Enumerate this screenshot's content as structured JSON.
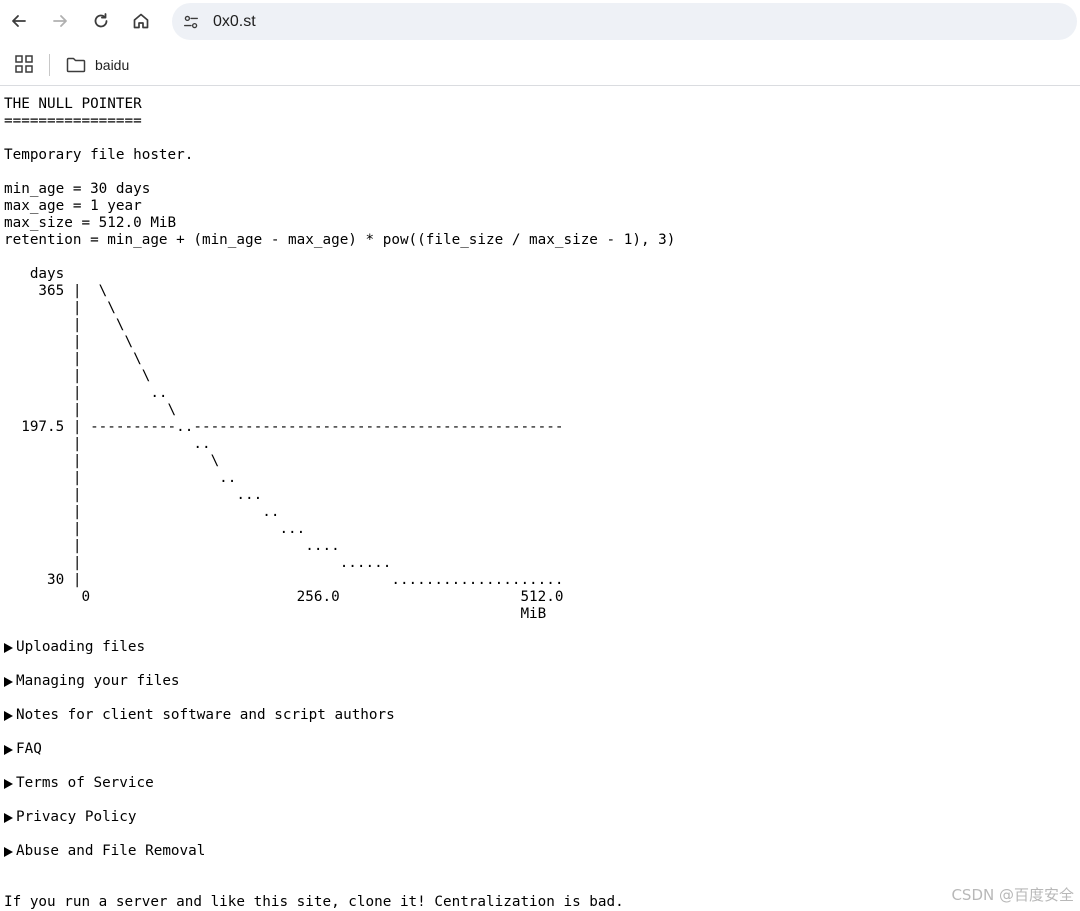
{
  "browser": {
    "url": "0x0.st",
    "bookmarks": [
      {
        "label": "baidu"
      }
    ]
  },
  "page": {
    "title": "THE NULL POINTER",
    "underline": "================",
    "tagline": "Temporary file hoster.",
    "params": [
      "min_age = 30 days",
      "max_age = 1 year",
      "max_size = 512.0 MiB",
      "retention = min_age + (min_age - max_age) * pow((file_size / max_size - 1), 3)"
    ],
    "chart_lines": [
      "   days",
      "    365 |  \\",
      "        |   \\",
      "        |    \\",
      "        |     \\",
      "        |      \\",
      "        |       \\",
      "        |        ..",
      "        |          \\",
      "  197.5 | ----------..-------------------------------------------",
      "        |             ..",
      "        |               \\",
      "        |                ..",
      "        |                  ...",
      "        |                     ..",
      "        |                       ...",
      "        |                          ....",
      "        |                              ......",
      "     30 |                                    ....................",
      "         0                        256.0                     512.0",
      "                                                            MiB"
    ],
    "sections": [
      "Uploading files",
      "Managing your files",
      "Notes for client software and script authors",
      "FAQ",
      "Terms of Service",
      "Privacy Policy",
      "Abuse and File Removal"
    ],
    "footer": "If you run a server and like this site, clone it! Centralization is bad."
  },
  "watermark": "CSDN @百度安全",
  "icons": [
    "back-arrow-icon",
    "forward-arrow-icon",
    "reload-icon",
    "home-icon",
    "site-settings-icon",
    "apps-grid-icon",
    "folder-icon",
    "disclosure-triangle-icon"
  ]
}
